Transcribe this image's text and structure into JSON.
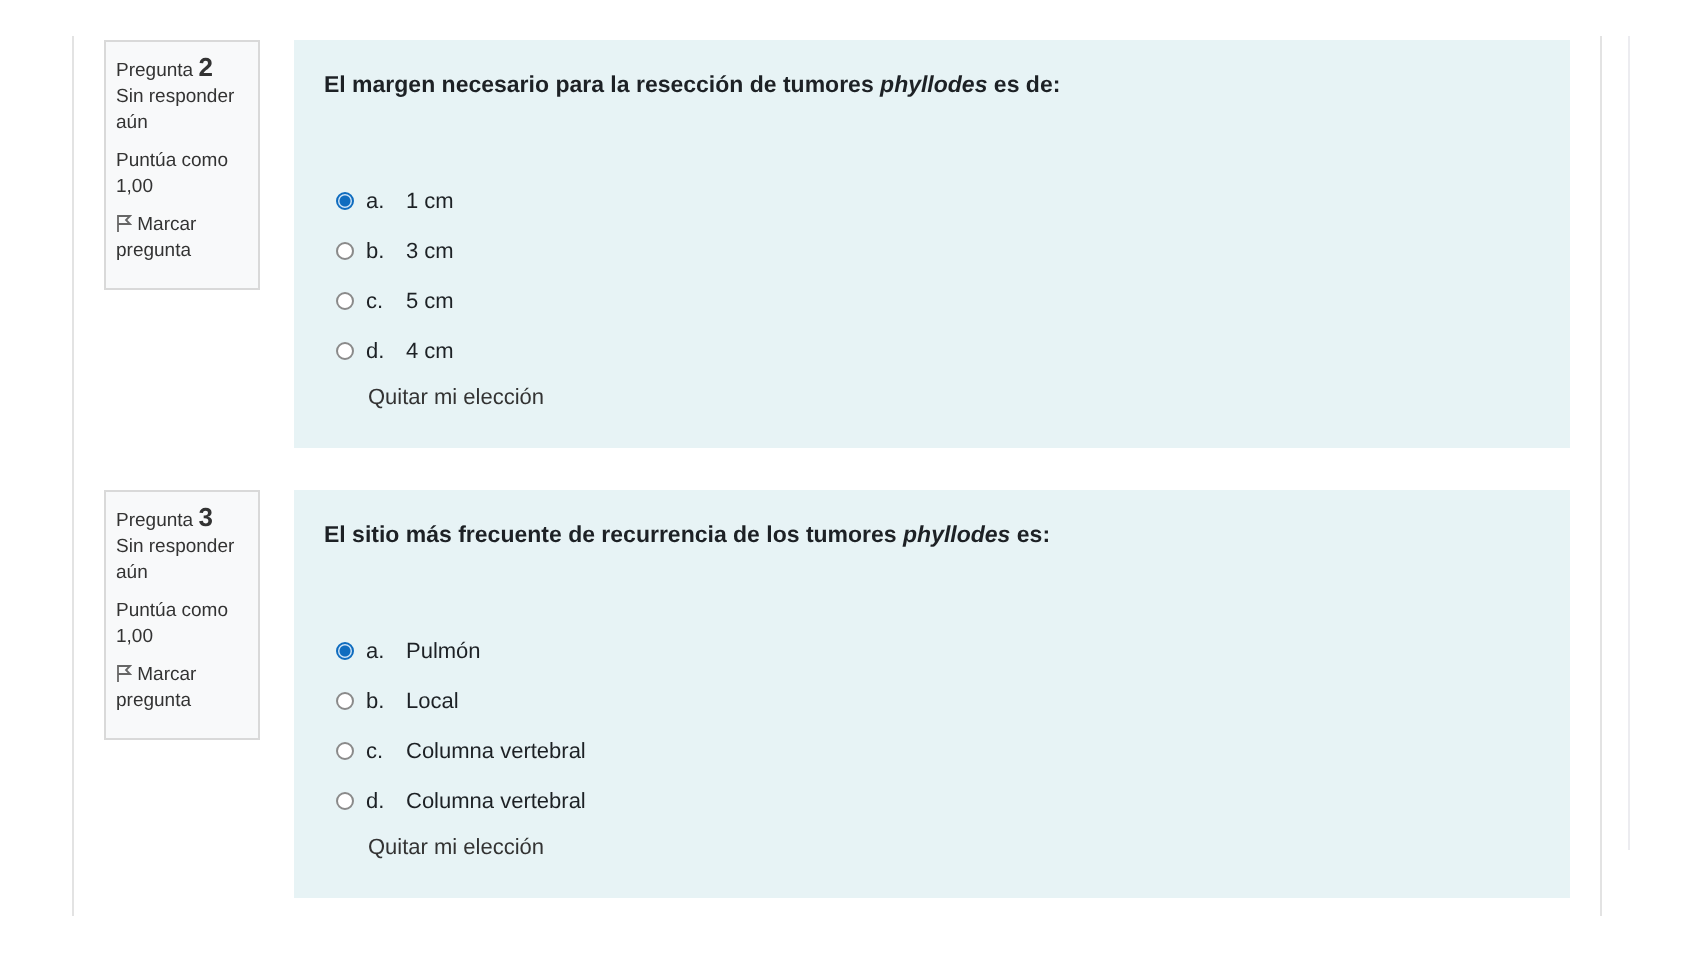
{
  "questions": [
    {
      "label": "Pregunta",
      "number": "2",
      "status": "Sin responder aún",
      "grade": "Puntúa como 1,00",
      "flag": "Marcar pregunta",
      "text": "El margen necesario para la resección de tumores *phyllodes* es de:",
      "options": [
        {
          "letter": "a.",
          "text": "1 cm",
          "selected": true
        },
        {
          "letter": "b.",
          "text": "3 cm",
          "selected": false
        },
        {
          "letter": "c.",
          "text": "5 cm",
          "selected": false
        },
        {
          "letter": "d.",
          "text": "4 cm",
          "selected": false
        }
      ],
      "clear": "Quitar mi elección"
    },
    {
      "label": "Pregunta",
      "number": "3",
      "status": "Sin responder aún",
      "grade": "Puntúa como 1,00",
      "flag": "Marcar pregunta",
      "text": "El sitio más frecuente de recurrencia de los tumores *phyllodes* es:",
      "options": [
        {
          "letter": "a.",
          "text": "Pulmón",
          "selected": true
        },
        {
          "letter": "b.",
          "text": "Local",
          "selected": false
        },
        {
          "letter": "c.",
          "text": "Columna vertebral",
          "selected": false
        },
        {
          "letter": "d.",
          "text": "Columna vertebral",
          "selected": false
        }
      ],
      "clear": "Quitar mi elección"
    }
  ]
}
